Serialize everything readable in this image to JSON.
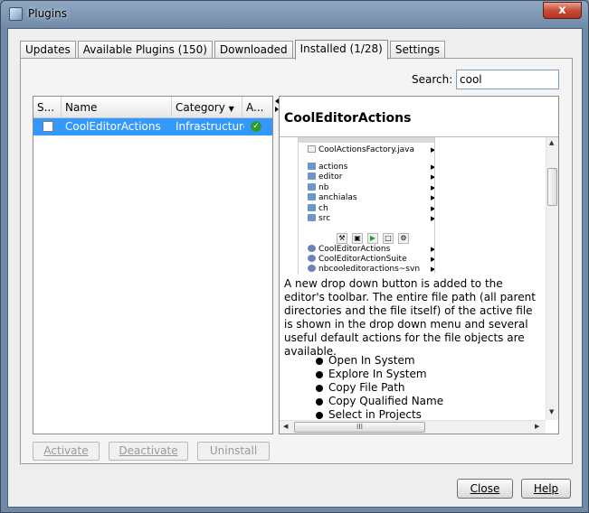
{
  "window": {
    "title": "Plugins",
    "close_glyph": "x"
  },
  "tabs": [
    {
      "label": "Updates",
      "active": false
    },
    {
      "label": "Available Plugins (150)",
      "active": false
    },
    {
      "label": "Downloaded",
      "active": false
    },
    {
      "label": "Installed (1/28)",
      "active": true
    },
    {
      "label": "Settings",
      "active": false
    }
  ],
  "search": {
    "label": "Search:",
    "value": "cool"
  },
  "table": {
    "columns": [
      "S...",
      "Name",
      "Category",
      "A..."
    ],
    "rows": [
      {
        "selected": false,
        "name": "CoolEditorActions",
        "category": "Infrastructure",
        "active": true
      }
    ]
  },
  "detail": {
    "title": "CoolEditorActions",
    "screenshot_tree": [
      {
        "label": "CoolActionsFactory.java",
        "icon": "java-file-icon"
      },
      {
        "label": "actions",
        "icon": "folder-icon"
      },
      {
        "label": "editor",
        "icon": "folder-icon"
      },
      {
        "label": "nb",
        "icon": "folder-icon"
      },
      {
        "label": "anchialas",
        "icon": "folder-icon"
      },
      {
        "label": "ch",
        "icon": "folder-icon"
      },
      {
        "label": "src",
        "icon": "folder-icon"
      },
      {
        "label": "CoolEditorActions",
        "icon": "package-icon"
      },
      {
        "label": "CoolEditorActionSuite",
        "icon": "package-icon"
      },
      {
        "label": "nbcooleditoractions~svn",
        "icon": "package-icon"
      }
    ],
    "description": "A new drop down button is added to the editor's toolbar. The entire file path (all parent directories and the file itself) of the active file is shown in the drop down menu and several useful default actions for the file objects are available.",
    "bullets": [
      "Open In System",
      "Explore In System",
      "Copy File Path",
      "Copy Qualified Name",
      "Select in Projects"
    ],
    "hscroll_grip": "III"
  },
  "actions": {
    "activate": "Activate",
    "deactivate": "Deactivate",
    "uninstall": "Uninstall"
  },
  "footer": {
    "close": "Close",
    "help": "Help"
  },
  "colors": {
    "selection": "#3399ff",
    "titlebar": "#8fa7c3",
    "active_check": "#2f9a2f"
  }
}
